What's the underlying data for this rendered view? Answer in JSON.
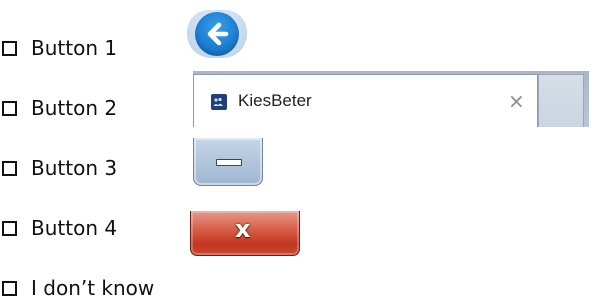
{
  "options": [
    {
      "label": "Button 1"
    },
    {
      "label": "Button 2"
    },
    {
      "label": "Button 3"
    },
    {
      "label": "Button 4"
    },
    {
      "label": "I don’t know"
    }
  ],
  "browser_tab": {
    "title": "KiesBeter",
    "close_glyph": "×",
    "favicon": "kiesbeter-favicon"
  },
  "window_controls": {
    "back_icon": "back-arrow-icon",
    "minimize_icon": "minimize-icon",
    "close_glyph": "x"
  },
  "colors": {
    "back_blue": "#1c7fd4",
    "close_red": "#c1361f",
    "minimize_blue": "#b2c5dc",
    "favicon_navy": "#1f3f7a"
  }
}
